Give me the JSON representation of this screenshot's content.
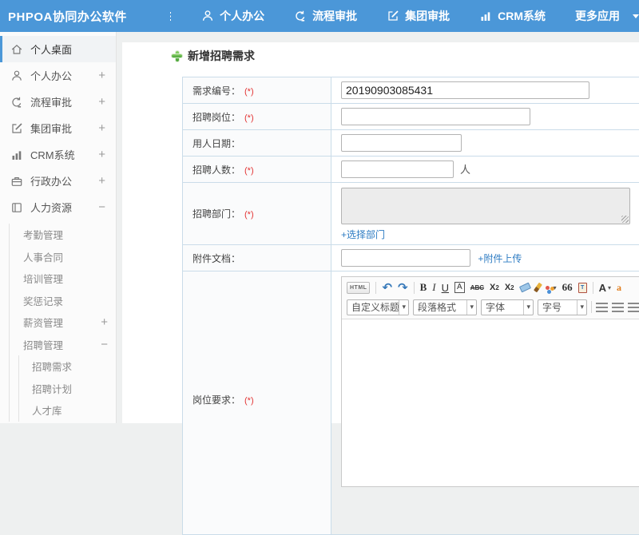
{
  "colors": {
    "accent": "#4b97d8",
    "link": "#2e7cc3",
    "required": "#e33333",
    "title_plus_green": "#58b957"
  },
  "topbar": {
    "logo": "PHPOA协同办公软件",
    "nav": [
      {
        "label": "个人办公",
        "icon": "person-icon"
      },
      {
        "label": "流程审批",
        "icon": "flow-arrow-icon"
      },
      {
        "label": "集团审批",
        "icon": "edit-square-icon"
      },
      {
        "label": "CRM系统",
        "icon": "bar-chart-icon"
      },
      {
        "label": "更多应用",
        "icon": "caret-down-icon"
      }
    ]
  },
  "sidebar": {
    "items": [
      {
        "label": "个人桌面",
        "icon": "home-icon",
        "active": true
      },
      {
        "label": "个人办公",
        "icon": "person-icon",
        "expand": "+"
      },
      {
        "label": "流程审批",
        "icon": "flow-arrow-icon",
        "expand": "+"
      },
      {
        "label": "集团审批",
        "icon": "edit-square-icon",
        "expand": "+"
      },
      {
        "label": "CRM系统",
        "icon": "bar-chart-icon",
        "expand": "+"
      },
      {
        "label": "行政办公",
        "icon": "briefcase-icon",
        "expand": "+"
      },
      {
        "label": "人力资源",
        "icon": "book-icon",
        "expand": "−"
      }
    ],
    "hr_children": [
      {
        "label": "考勤管理"
      },
      {
        "label": "人事合同"
      },
      {
        "label": "培训管理"
      },
      {
        "label": "奖惩记录"
      },
      {
        "label": "薪资管理",
        "expand": "+"
      },
      {
        "label": "招聘管理",
        "expand": "−"
      }
    ],
    "recruit_children": [
      {
        "label": "招聘需求"
      },
      {
        "label": "招聘计划"
      },
      {
        "label": "人才库"
      }
    ]
  },
  "main": {
    "title": "新增招聘需求",
    "form": {
      "req_no": {
        "label": "需求编号：",
        "required": "(*)",
        "value": "20190903085431"
      },
      "position": {
        "label": "招聘岗位：",
        "required": "(*)"
      },
      "hire_date": {
        "label": "用人日期："
      },
      "headcount": {
        "label": "招聘人数：",
        "required": "(*)",
        "suffix": "人"
      },
      "department": {
        "label": "招聘部门：",
        "required": "(*)",
        "link": "+选择部门"
      },
      "attachment": {
        "label": "附件文档：",
        "link": "+附件上传"
      },
      "requirement": {
        "label": "岗位要求：",
        "required": "(*)"
      }
    },
    "editor": {
      "html_btn": "HTML",
      "glyphs": {
        "undo": "↶",
        "redo": "↷",
        "bold": "B",
        "italic": "I",
        "underline": "U",
        "char_border": "A",
        "strike": "ABC",
        "sup_base": "X",
        "sup": "2",
        "sub_base": "X",
        "sub": "2",
        "quote": "66",
        "paste": "T",
        "font_color": "A",
        "back_color": "a",
        "caret": "▾"
      },
      "toolbar_icons": [
        "html-source",
        "undo",
        "redo",
        "bold",
        "italic",
        "underline",
        "char-border",
        "strikethrough",
        "superscript",
        "subscript",
        "eraser",
        "format-brush",
        "highlight-color",
        "blockquote",
        "paste",
        "font-color",
        "background-color"
      ],
      "dropdowns": [
        {
          "label": "自定义标题"
        },
        {
          "label": "段落格式"
        },
        {
          "label": "字体"
        },
        {
          "label": "字号"
        }
      ],
      "alignments": [
        "align-left",
        "align-center",
        "align-right",
        "align-justify"
      ]
    }
  }
}
